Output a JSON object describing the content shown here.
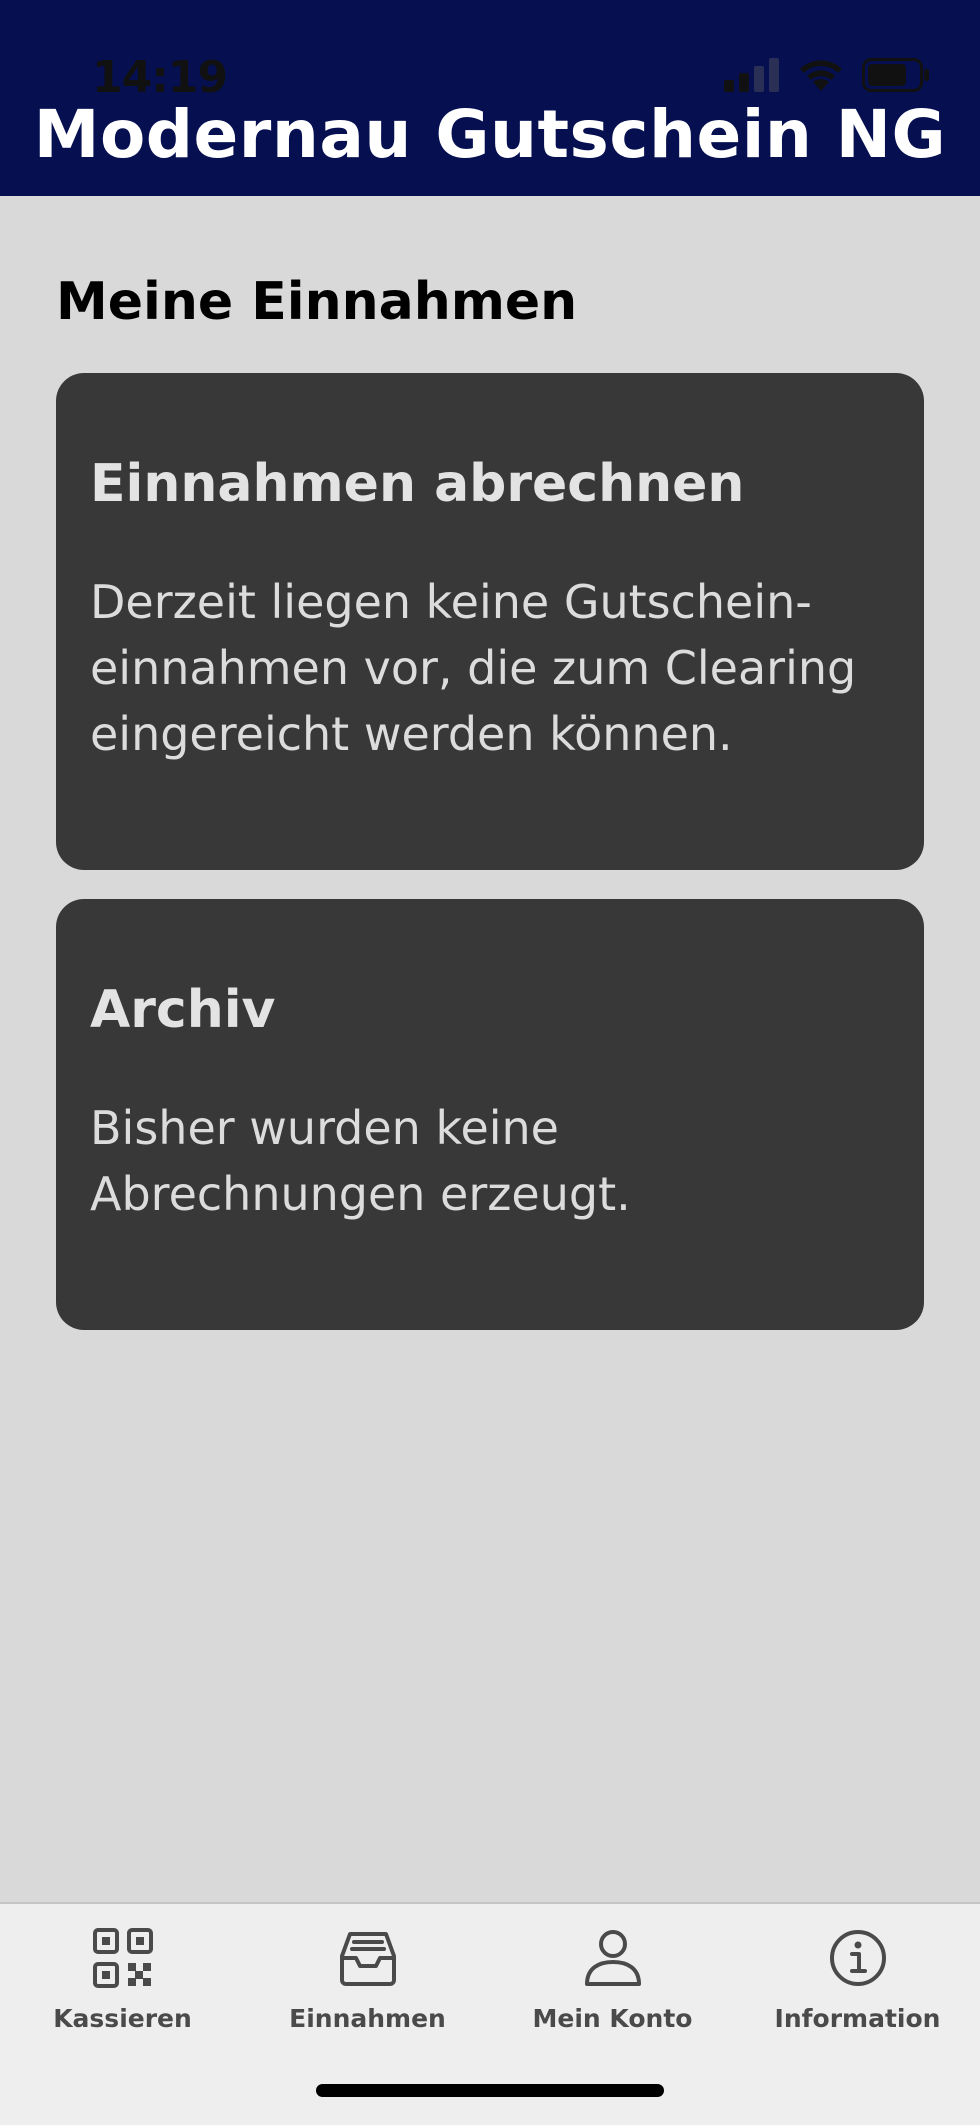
{
  "status_bar": {
    "time": "14:19"
  },
  "header": {
    "title": "Modernau Gutschein NG"
  },
  "main": {
    "section_title": "Meine Einnahmen",
    "cards": [
      {
        "title": "Einnahmen abrechnen",
        "text": "Derzeit liegen keine Gutschein-einnahmen vor, die zum Clearing eingereicht werden können."
      },
      {
        "title": "Archiv",
        "text": "Bisher wurden keine Abrechnungen erzeugt."
      }
    ]
  },
  "tab_bar": {
    "items": [
      {
        "label": "Kassieren",
        "icon": "qr-code-icon"
      },
      {
        "label": "Einnahmen",
        "icon": "inbox-tray-icon"
      },
      {
        "label": "Mein Konto",
        "icon": "user-icon"
      },
      {
        "label": "Information",
        "icon": "info-icon"
      }
    ]
  },
  "colors": {
    "header_background": "#061051",
    "page_background": "#d9d9d9",
    "card_background": "#383838",
    "tab_bar_background": "#eeeeee"
  }
}
